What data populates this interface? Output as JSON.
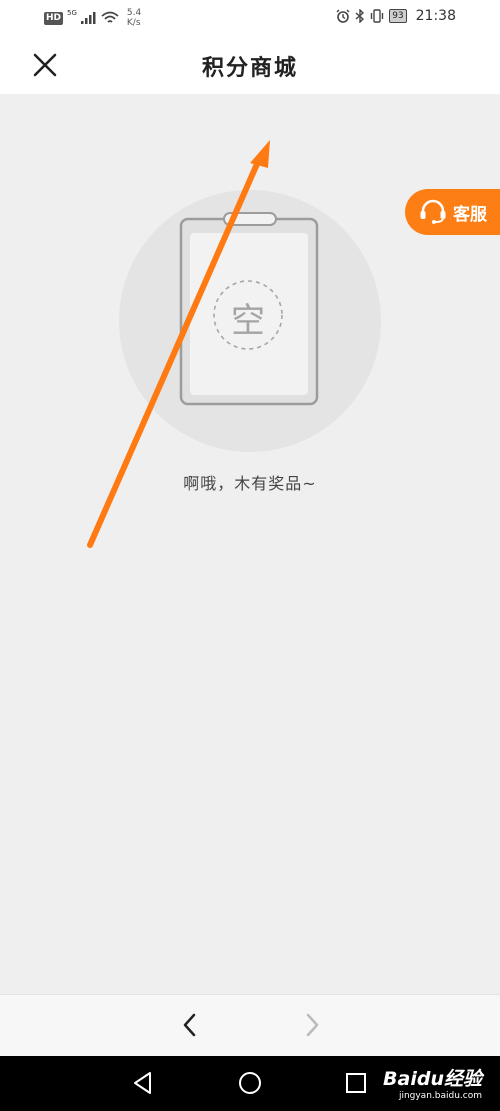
{
  "status_bar": {
    "hd_badge": "HD",
    "network_gen": "5G",
    "net_speed_value": "5.4",
    "net_speed_unit": "K/s",
    "battery_level": "93",
    "time": "21:38"
  },
  "header": {
    "title": "积分商城",
    "close_icon": "close-icon"
  },
  "customer_service": {
    "label": "客服",
    "icon": "headset-icon",
    "color": "#fd7e14"
  },
  "empty_state": {
    "placeholder_char": "空",
    "message": "啊哦，木有奖品~",
    "icon": "empty-clipboard-icon"
  },
  "annotation": {
    "arrow_color": "#ff7a12",
    "icon": "annotation-arrow"
  },
  "browser_nav": {
    "back_icon": "chevron-left-icon",
    "forward_icon": "chevron-right-icon"
  },
  "system_nav": {
    "back_icon": "triangle-back-icon",
    "home_icon": "circle-home-icon",
    "recents_icon": "square-recents-icon"
  },
  "watermark": {
    "main": "Baidu经验",
    "sub": "jingyan.baidu.com"
  }
}
